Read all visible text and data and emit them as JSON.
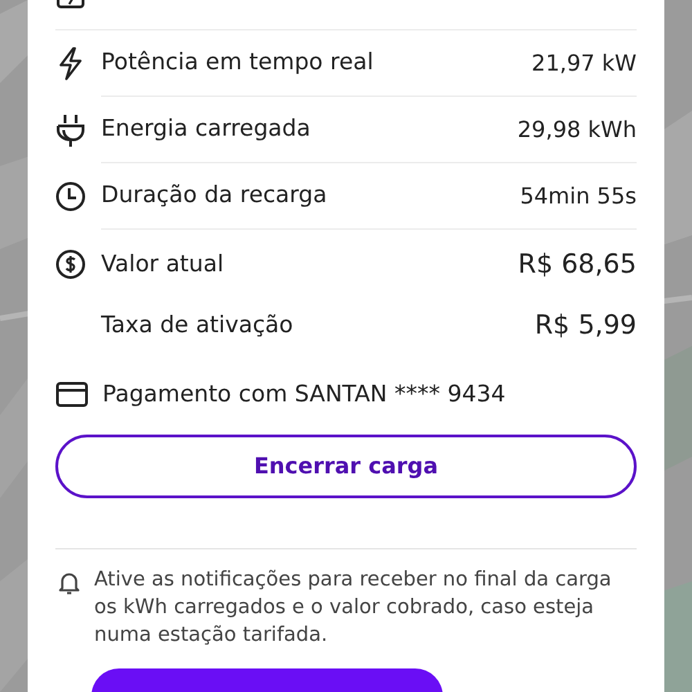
{
  "details": [
    {
      "kind": "metric",
      "label": "Potência em tempo real",
      "value": "21,97 kW"
    },
    {
      "kind": "metric",
      "label": "Energia carregada",
      "value": "29,98 kWh"
    },
    {
      "kind": "metric",
      "label": "Duração da recarga",
      "value": "54min 55s"
    },
    {
      "kind": "total",
      "label": "Valor atual",
      "value": "R$ 68,65"
    },
    {
      "kind": "fee",
      "label": "Taxa de ativação",
      "value": "R$ 5,99"
    }
  ],
  "payment": "Pagamento com SANTAN **** 9434",
  "end_button": "Encerrar carga",
  "notice": "Ative as notificações para receber no final da carga os kWh carregados e o valor cobrado, caso esteja numa estação tarifada."
}
